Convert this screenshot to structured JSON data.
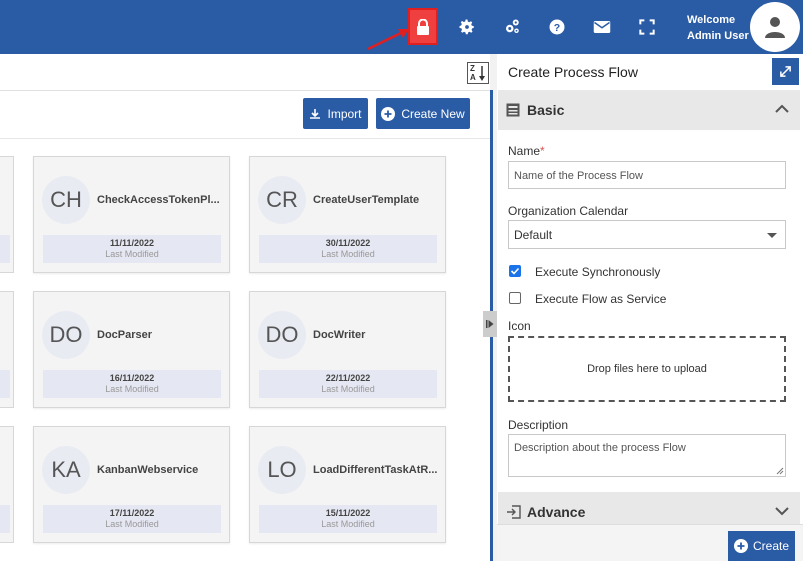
{
  "topbar": {
    "welcome_line1": "Welcome",
    "welcome_line2": "Admin User",
    "icons": [
      "lock-icon",
      "gear-icon",
      "cogs-icon",
      "help-icon",
      "mail-icon",
      "fullscreen-icon"
    ],
    "lock_highlight_color": "#ef3f3f"
  },
  "toolbar": {
    "import_label": "Import",
    "create_new_label": "Create New"
  },
  "cards": [
    {
      "initials": "CH",
      "name": "CheckAccessTokenPl...",
      "date": "11/11/2022",
      "meta": "Last Modified"
    },
    {
      "initials": "CR",
      "name": "CreateUserTemplate",
      "date": "30/11/2022",
      "meta": "Last Modified"
    },
    {
      "initials": "DO",
      "name": "DocParser",
      "date": "16/11/2022",
      "meta": "Last Modified"
    },
    {
      "initials": "DO",
      "name": "DocWriter",
      "date": "22/11/2022",
      "meta": "Last Modified"
    },
    {
      "initials": "KA",
      "name": "KanbanWebservice",
      "date": "17/11/2022",
      "meta": "Last Modified"
    },
    {
      "initials": "LO",
      "name": "LoadDifferentTaskAtR...",
      "date": "15/11/2022",
      "meta": "Last Modified"
    }
  ],
  "panel": {
    "title": "Create Process Flow",
    "basic_section": "Basic",
    "name_label": "Name",
    "name_required": "*",
    "name_placeholder": "Name of the Process Flow",
    "calendar_label": "Organization Calendar",
    "calendar_value": "Default",
    "exec_sync_label": "Execute Synchronously",
    "exec_sync_checked": true,
    "exec_service_label": "Execute Flow as Service",
    "exec_service_checked": false,
    "icon_label": "Icon",
    "drop_text": "Drop files here to upload",
    "description_label": "Description",
    "description_placeholder": "Description about the process Flow",
    "advance_section": "Advance",
    "create_label": "Create"
  },
  "colors": {
    "primary": "#2a5ba5",
    "accent_red": "#e02020"
  }
}
